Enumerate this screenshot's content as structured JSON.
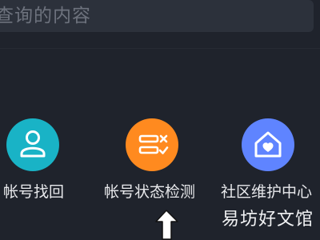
{
  "search": {
    "placeholder_text": "查询的内容"
  },
  "services": [
    {
      "label": "帐号找回",
      "icon": "person-icon",
      "color": "#19b3c6"
    },
    {
      "label": "帐号状态检测",
      "icon": "checklist-icon",
      "color": "#ff8a1f"
    },
    {
      "label": "社区维护中心",
      "icon": "home-heart-icon",
      "color": "#5f84ff"
    }
  ],
  "watermark": {
    "text": "易坊好文馆"
  },
  "pointer": {
    "icon": "up-arrow-icon"
  }
}
